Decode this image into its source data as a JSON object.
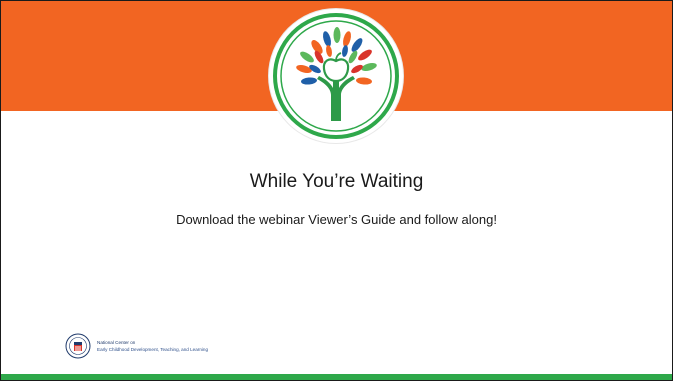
{
  "slide": {
    "title": "While You’re Waiting",
    "subtitle": "Download the webinar Viewer’s Guide and follow along!"
  },
  "footer": {
    "org_line1": "National Center on",
    "org_line2": "Early Childhood Development, Teaching, and Learning",
    "seal_text": "OFFICE OF HEAD START"
  },
  "colors": {
    "top_band": "#f26522",
    "bottom_band": "#2ea84a",
    "logo_ring": "#2ea84a",
    "leaf_orange": "#f26522",
    "leaf_blue": "#1f5fa8",
    "leaf_green": "#5cb85c",
    "leaf_red": "#d9342b",
    "trunk": "#2e9a48"
  },
  "icons": {
    "logo": "tree-logo-icon",
    "seal": "head-start-seal-icon"
  }
}
